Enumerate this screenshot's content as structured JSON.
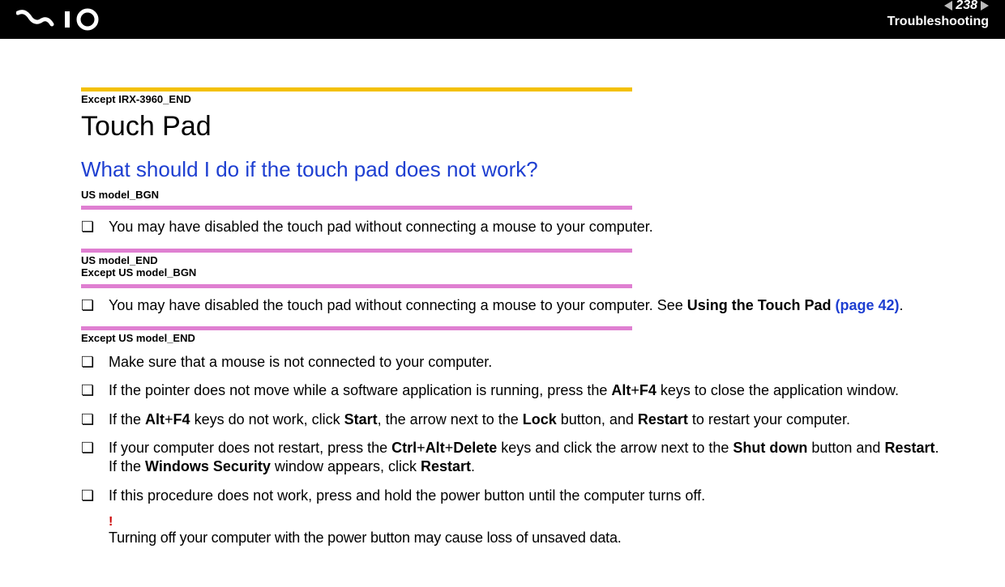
{
  "header": {
    "page_number": "238",
    "section": "Troubleshooting"
  },
  "content": {
    "tag_except_irx": "Except IRX-3960_END",
    "title": "Touch Pad",
    "question": "What should I do if the touch pad does not work?",
    "tag_us_bgn": "US model_BGN",
    "bullet_us": "You may have disabled the touch pad without connecting a mouse to your computer.",
    "tag_us_end": "US model_END",
    "tag_except_us_bgn": "Except US model_BGN",
    "bullet_except_us_pre": "You may have disabled the touch pad without connecting a mouse to your computer. See ",
    "bullet_except_us_bold": "Using the Touch Pad ",
    "bullet_except_us_link": "(page 42)",
    "bullet_except_us_post": ".",
    "tag_except_us_end": "Except US model_END",
    "bullet_mouse": "Make sure that a mouse is not connected to your computer.",
    "bullet_altf4_pre": "If the pointer does not move while a software application is running, press the ",
    "bullet_altf4_key1": "Alt",
    "bullet_altf4_plus1": "+",
    "bullet_altf4_key2": "F4",
    "bullet_altf4_post": " keys to close the application window.",
    "bullet_restart_pre": "If the ",
    "bullet_restart_key1": "Alt",
    "bullet_restart_plus": "+",
    "bullet_restart_key2": "F4",
    "bullet_restart_mid1": " keys do not work, click ",
    "bullet_restart_start": "Start",
    "bullet_restart_mid2": ", the arrow next to the ",
    "bullet_restart_lock": "Lock",
    "bullet_restart_mid3": " button, and ",
    "bullet_restart_restart": "Restart",
    "bullet_restart_end": " to restart your computer.",
    "bullet_cad_pre": "If your computer does not restart, press the ",
    "bullet_cad_key1": "Ctrl",
    "bullet_cad_plus1": "+",
    "bullet_cad_key2": "Alt",
    "bullet_cad_plus2": "+",
    "bullet_cad_key3": "Delete",
    "bullet_cad_mid1": " keys and click the arrow next to the ",
    "bullet_cad_shut": "Shut down",
    "bullet_cad_mid2": " button and ",
    "bullet_cad_restart": "Restart",
    "bullet_cad_end": ".",
    "bullet_cad_line2_pre": "If the ",
    "bullet_cad_line2_ws": "Windows Security",
    "bullet_cad_line2_mid": " window appears, click ",
    "bullet_cad_line2_restart": "Restart",
    "bullet_cad_line2_end": ".",
    "bullet_power": "If this procedure does not work, press and hold the power button until the computer turns off.",
    "caution_mark": "!",
    "caution": "Turning off your computer with the power button may cause loss of unsaved data."
  }
}
